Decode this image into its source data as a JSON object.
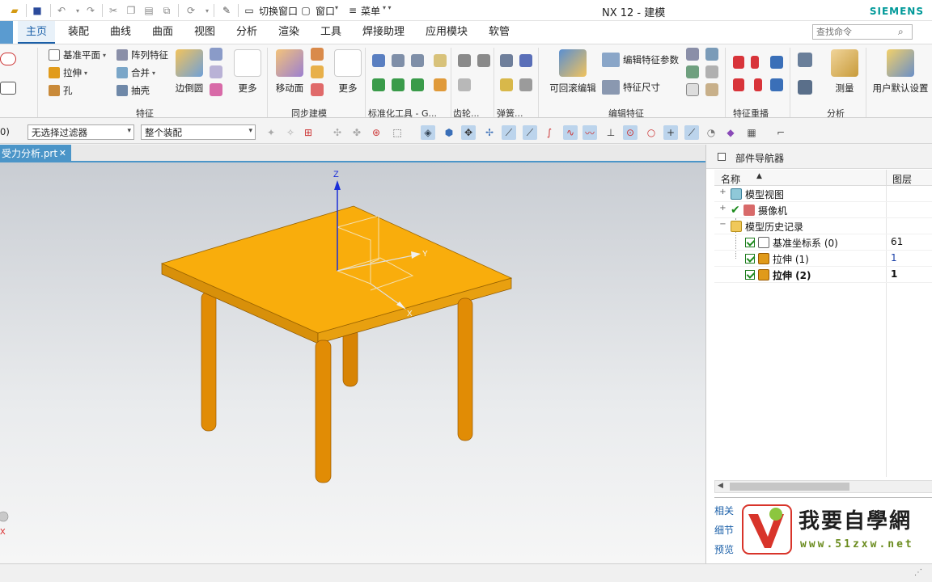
{
  "window": {
    "title": "NX 12 - 建模",
    "brand": "SIEMENS",
    "quick_access": {
      "switch_window_label": "切换窗口",
      "window_label": "窗口",
      "menu_label": "菜单"
    }
  },
  "menu_tabs": [
    {
      "label": "主页",
      "active": true
    },
    {
      "label": "装配"
    },
    {
      "label": "曲线"
    },
    {
      "label": "曲面"
    },
    {
      "label": "视图"
    },
    {
      "label": "分析"
    },
    {
      "label": "渲染"
    },
    {
      "label": "工具"
    },
    {
      "label": "焊接助理"
    },
    {
      "label": "应用模块"
    },
    {
      "label": "软管"
    }
  ],
  "search": {
    "placeholder": "查找命令"
  },
  "ribbon": {
    "feature": {
      "datum_plane": "基准平面",
      "pattern_feature": "阵列特征",
      "extrude": "拉伸",
      "unite": "合并",
      "hole": "孔",
      "shell": "抽壳",
      "edge_blend": "边倒圆",
      "more": "更多",
      "group_label": "特征"
    },
    "sync": {
      "move_face": "移动面",
      "more": "更多",
      "group_label": "同步建模"
    },
    "std_tools": {
      "group_label": "标准化工具 - G..."
    },
    "gear": {
      "group_label": "齿轮..."
    },
    "spring": {
      "group_label": "弹簧..."
    },
    "edit_feature": {
      "rollback_edit": "可回滚编辑",
      "edit_params": "编辑特征参数",
      "feature_dim": "特征尺寸",
      "group_label": "编辑特征"
    },
    "replay": {
      "group_label": "特征重播"
    },
    "analysis": {
      "measure": "测量",
      "group_label": "分析"
    },
    "user_defaults": "用户默认设置"
  },
  "toolbar2": {
    "partial_label": "0)",
    "filter": "无选择过滤器",
    "scope": "整个装配"
  },
  "document_tab": {
    "label": "受力分析.prt",
    "close": "✕"
  },
  "viewport": {
    "axis_z": "Z",
    "axis_y": "Y",
    "axis_x": "X",
    "corner_x": "X",
    "table_color": "#f9ad0c",
    "leg_color": "#e18c05"
  },
  "navigator": {
    "title": "部件导航器",
    "col_name": "名称",
    "col_layer": "图层",
    "tree": [
      {
        "label": "模型视图",
        "layer": "",
        "indent": 0,
        "expander": "+"
      },
      {
        "label": "摄像机",
        "layer": "",
        "indent": 0,
        "expander": "+"
      },
      {
        "label": "模型历史记录",
        "layer": "",
        "indent": 0,
        "expander": "−"
      },
      {
        "label": "基准坐标系 (0)",
        "layer": "61",
        "indent": 1,
        "checked": true
      },
      {
        "label": "拉伸 (1)",
        "layer": "1",
        "indent": 1,
        "checked": true
      },
      {
        "label": "拉伸 (2)",
        "layer": "1",
        "indent": 1,
        "checked": true,
        "bold": true
      }
    ],
    "side_tabs": [
      "相关",
      "细节",
      "预览"
    ]
  },
  "watermark": {
    "title": "我要自學網",
    "url": "www.51zxw.net"
  }
}
